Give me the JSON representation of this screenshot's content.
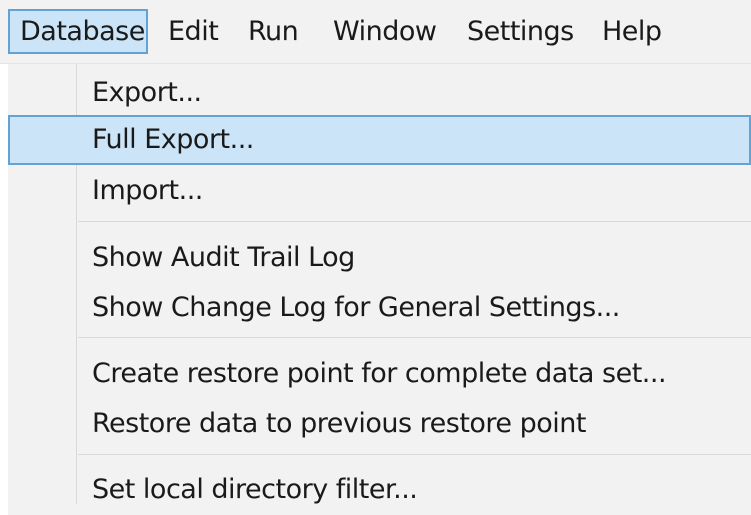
{
  "menubar": {
    "items": [
      {
        "label": "Database",
        "active": true
      },
      {
        "label": "Edit"
      },
      {
        "label": "Run"
      },
      {
        "label": "Window"
      },
      {
        "label": "Settings"
      },
      {
        "label": "Help"
      }
    ]
  },
  "dropdown": {
    "items": [
      {
        "label": "Export..."
      },
      {
        "label": "Full Export...",
        "highlighted": true
      },
      {
        "label": "Import..."
      },
      {
        "label": "Show Audit Trail Log"
      },
      {
        "label": "Show Change Log for General Settings..."
      },
      {
        "label": "Create restore point for complete data set..."
      },
      {
        "label": "Restore data to previous restore point"
      },
      {
        "label": "Set local directory filter..."
      }
    ]
  },
  "colors": {
    "menu_background": "#f2f2f2",
    "highlight_fill": "#cce4f7",
    "highlight_border": "#62a3d6",
    "separator": "#d9d9d9"
  }
}
